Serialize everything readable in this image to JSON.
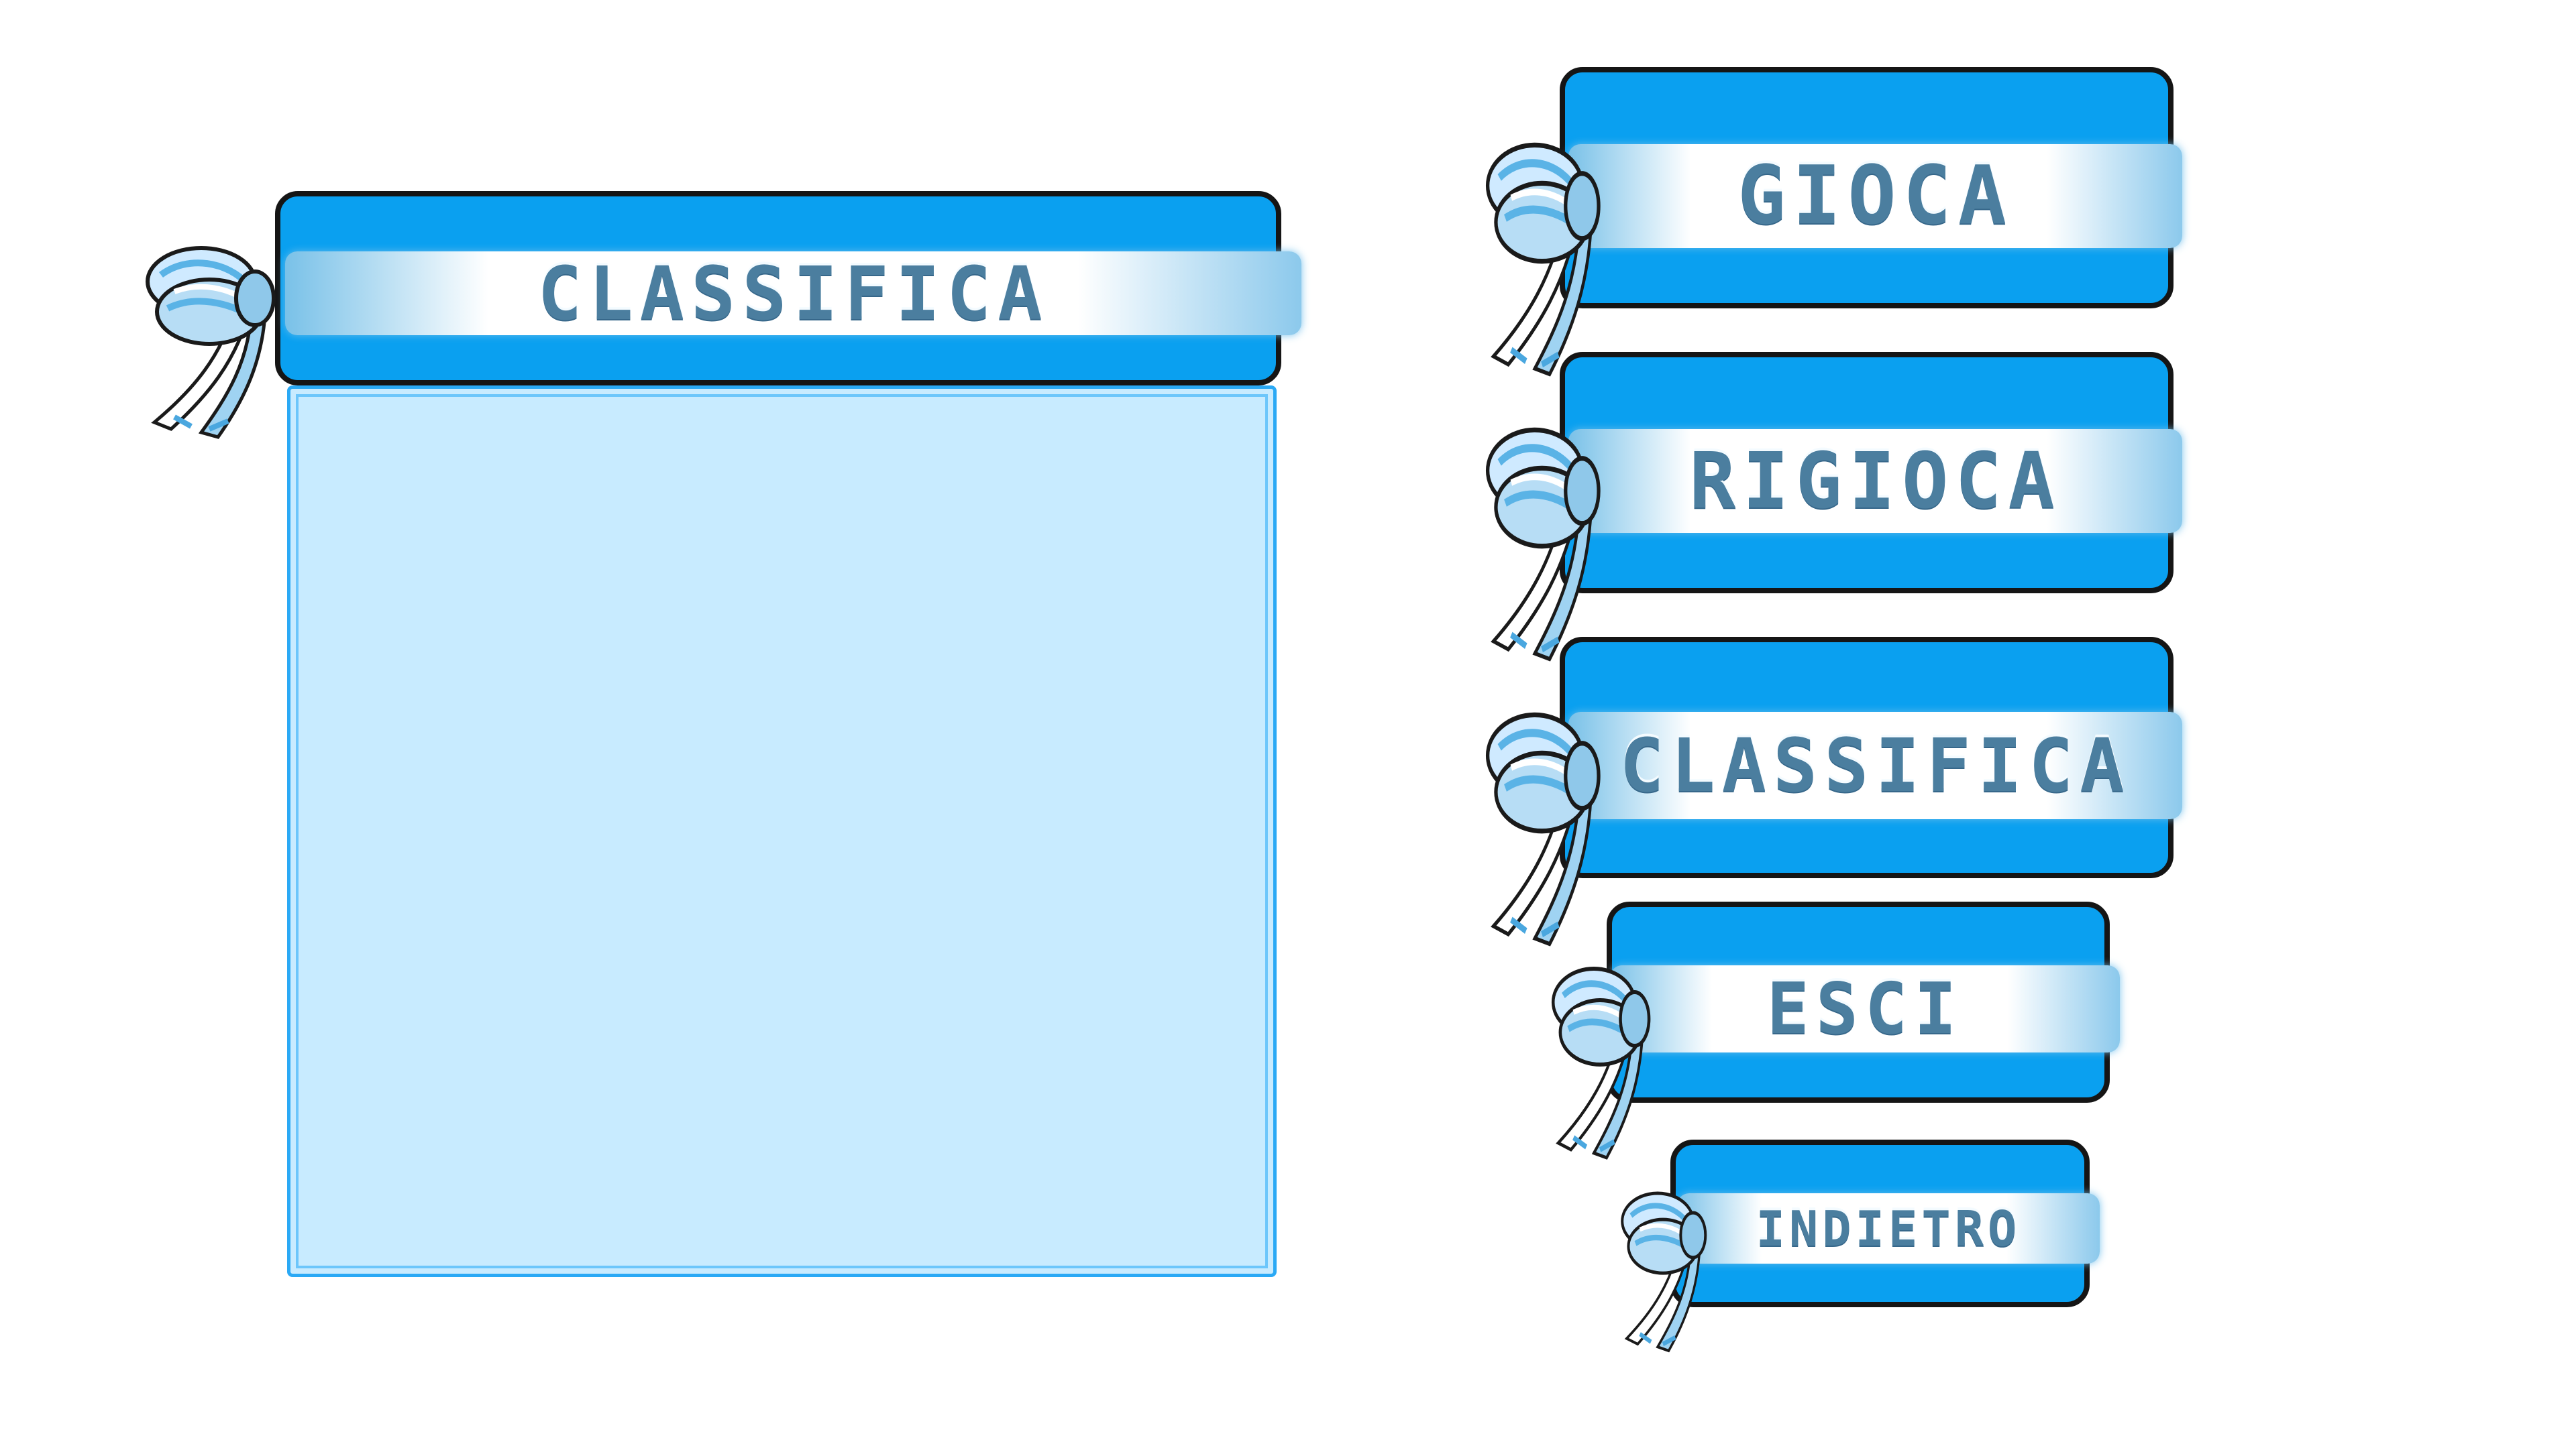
{
  "leaderboard": {
    "title": "CLASSIFICA"
  },
  "menu": {
    "play_label": "GIOCA",
    "replay_label": "RIGIOCA",
    "leaderboard_label": "CLASSIFICA",
    "exit_label": "ESCI",
    "back_label": "INDIETRO"
  },
  "colors": {
    "card_blue": "#0aa0f0",
    "panel_fill": "#c8ebff",
    "label_text": "#4b7e9f",
    "outline": "#151515",
    "ribbon": "#8fc8ea"
  },
  "icons": {
    "ribbon": "ribbon-bow-icon"
  }
}
